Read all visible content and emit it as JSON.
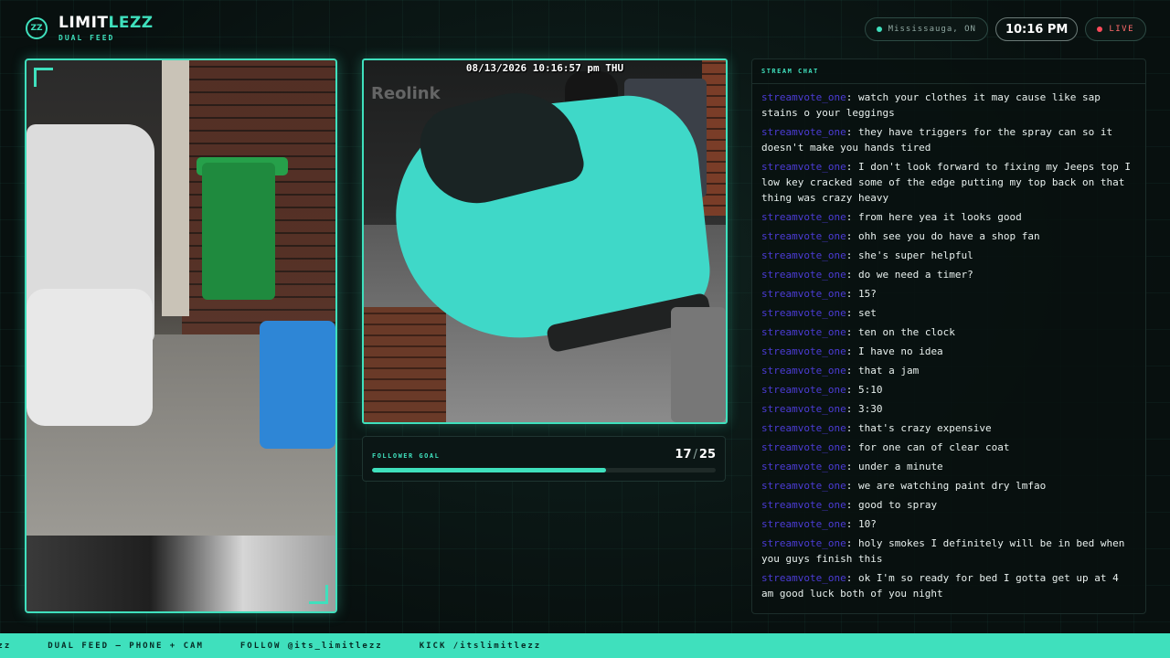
{
  "header": {
    "logo_text": "ZZ",
    "title_part1": "LIMIT",
    "title_part2": "LEZZ",
    "subtitle": "DUAL FEED",
    "location": "Mississauga, ON",
    "time": "10:16 PM",
    "live_label": "LIVE"
  },
  "cam_feed": {
    "timestamp": "08/13/2026 10:16:57 pm THU",
    "watermark": "Reolink"
  },
  "goal": {
    "label": "FOLLOWER GOAL",
    "current": "17",
    "target": "25",
    "progress": 0.68
  },
  "chat": {
    "title": "STREAM CHAT",
    "messages": [
      {
        "user": "streamvote_one",
        "text": "watch your clothes it may cause like sap stains o your leggings"
      },
      {
        "user": "streamvote_one",
        "text": "they have triggers for the spray can so it doesn't make you hands tired"
      },
      {
        "user": "streamvote_one",
        "text": "I don't look forward to fixing my Jeeps top I low key cracked some of the edge putting my top back on that thing was crazy heavy"
      },
      {
        "user": "streamvote_one",
        "text": "from here yea it looks good"
      },
      {
        "user": "streamvote_one",
        "text": "ohh see you do have a shop fan"
      },
      {
        "user": "streamvote_one",
        "text": "she's super helpful"
      },
      {
        "user": "streamvote_one",
        "text": "do we need a timer?"
      },
      {
        "user": "streamvote_one",
        "text": "15?"
      },
      {
        "user": "streamvote_one",
        "text": "set"
      },
      {
        "user": "streamvote_one",
        "text": "ten on the clock"
      },
      {
        "user": "streamvote_one",
        "text": "I have no idea"
      },
      {
        "user": "streamvote_one",
        "text": "that a jam"
      },
      {
        "user": "streamvote_one",
        "text": "5:10"
      },
      {
        "user": "streamvote_one",
        "text": "3:30"
      },
      {
        "user": "streamvote_one",
        "text": "that's crazy expensive"
      },
      {
        "user": "streamvote_one",
        "text": "for one can of clear coat"
      },
      {
        "user": "streamvote_one",
        "text": "under a minute"
      },
      {
        "user": "streamvote_one",
        "text": "we are watching paint dry lmfao"
      },
      {
        "user": "streamvote_one",
        "text": "good to spray"
      },
      {
        "user": "streamvote_one",
        "text": "10?"
      },
      {
        "user": "streamvote_one",
        "text": "holy smokes I definitely will be in bed when you guys finish this"
      },
      {
        "user": "streamvote_one",
        "text": "ok I'm so ready for bed I gotta get up at 4 am good luck both of you night"
      }
    ]
  },
  "ticker": {
    "items": [
      "ezz",
      "DUAL FEED — PHONE + CAM",
      "FOLLOW @its_limitlezz",
      "KICK /itslimitlezz"
    ]
  },
  "colors": {
    "accent": "#3fe0bd",
    "background": "#08100f",
    "live": "#ff4a5a",
    "chat_user": "#4c3cd6"
  }
}
